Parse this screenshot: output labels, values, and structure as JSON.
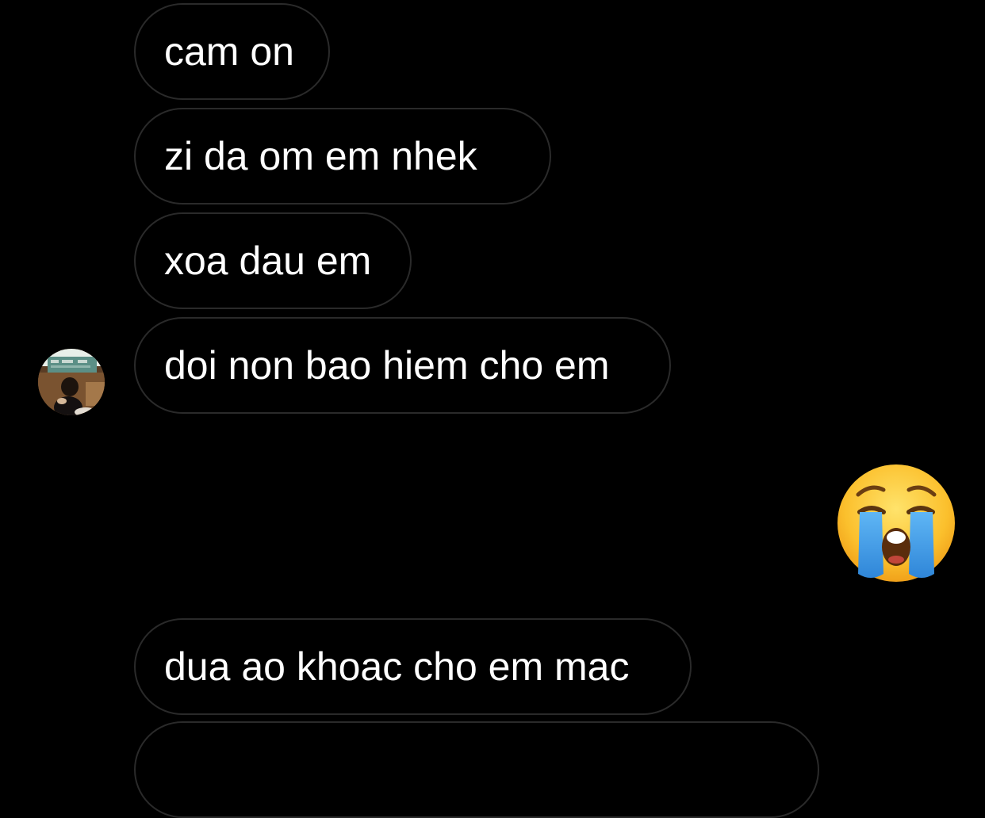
{
  "messages": [
    {
      "text": "cam on"
    },
    {
      "text": "zi da om em nhek"
    },
    {
      "text": "xoa dau em"
    },
    {
      "text": "doi non bao hiem cho em"
    },
    {
      "text": "dua ao khoac cho em mac"
    },
    {
      "text": ""
    }
  ],
  "reply": {
    "emoji": "loudly-crying-face-icon"
  },
  "avatar": {
    "icon": "profile-photo"
  },
  "colors": {
    "background": "#000000",
    "bubble_border": "#2a2a2a",
    "text": "#ffffff"
  }
}
